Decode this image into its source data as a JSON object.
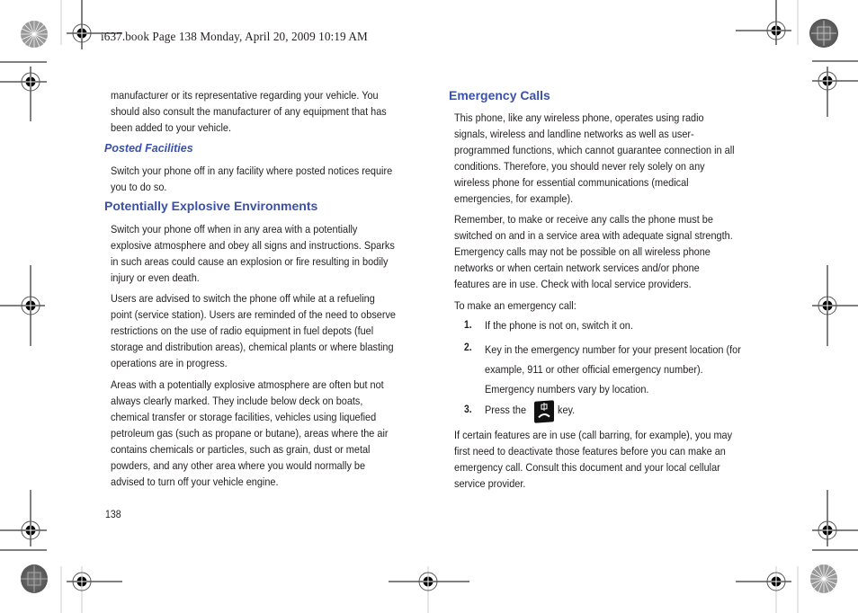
{
  "slug": "i637.book  Page 138  Monday, April 20, 2009  10:19 AM",
  "left_column": {
    "intro_lines": [
      "manufacturer or its representative regarding your vehicle. You",
      "should also consult the manufacturer of any equipment that has",
      "been added to your vehicle."
    ],
    "posted_heading": "Posted Facilities",
    "posted_lines": [
      "Switch your phone off in any facility where posted notices require",
      "you to do so."
    ],
    "explosive_heading": "Potentially Explosive Environments",
    "explosive_p1": [
      "Switch your phone off when in any area with a potentially",
      "explosive atmosphere and obey all signs and instructions. Sparks",
      "in such areas could cause an explosion or fire resulting in bodily",
      "injury or even death."
    ],
    "explosive_p2": [
      "Users are advised to switch the phone off while at a refueling",
      "point (service station). Users are reminded of the need to observe",
      "restrictions on the use of radio equipment in fuel depots (fuel",
      "storage and distribution areas), chemical plants or where blasting",
      "operations are in progress."
    ],
    "explosive_p3": [
      "Areas with a potentially explosive atmosphere are often but not",
      "always clearly marked. They include below deck on boats,",
      "chemical transfer or storage facilities, vehicles using liquefied",
      "petroleum gas (such as propane or butane), areas where the air",
      "contains chemicals or particles, such as grain, dust or metal",
      "powders, and any other area where you would normally be",
      "advised to turn off your vehicle engine."
    ]
  },
  "right_column": {
    "heading": "Emergency Calls",
    "p1": [
      "This phone, like any wireless phone, operates using radio",
      "signals, wireless and landline networks as well as user-",
      "programmed functions, which cannot guarantee connection in all",
      "conditions. Therefore, you should never rely solely on any",
      "wireless phone for essential communications (medical",
      "emergencies, for example)."
    ],
    "p2": [
      "Remember, to make or receive any calls the phone must be",
      "switched on and in a service area with adequate signal strength.",
      "Emergency calls may not be possible on all wireless phone",
      "networks or when certain network services and/or phone",
      "features are in use. Check with local service providers."
    ],
    "steps_intro": "To make an emergency call:",
    "steps": [
      {
        "num": "1.",
        "lines": [
          "If the phone is not on, switch it on."
        ]
      },
      {
        "num": "2.",
        "lines": [
          "Key in the emergency number for your present location (for",
          "example, 911 or other official emergency number).",
          "Emergency numbers vary by location."
        ]
      },
      {
        "num": "3.",
        "before": "Press the",
        "icon": "end-call-key-icon",
        "after": "key."
      }
    ],
    "p3": [
      "If certain features are in use (call barring, for example), you may",
      "first need to deactivate those features before you can make an",
      "emergency call. Consult this document and your local cellular",
      "service provider."
    ]
  },
  "page_number": "138",
  "colors": {
    "heading": "#3a51a7",
    "text": "#231f20"
  }
}
